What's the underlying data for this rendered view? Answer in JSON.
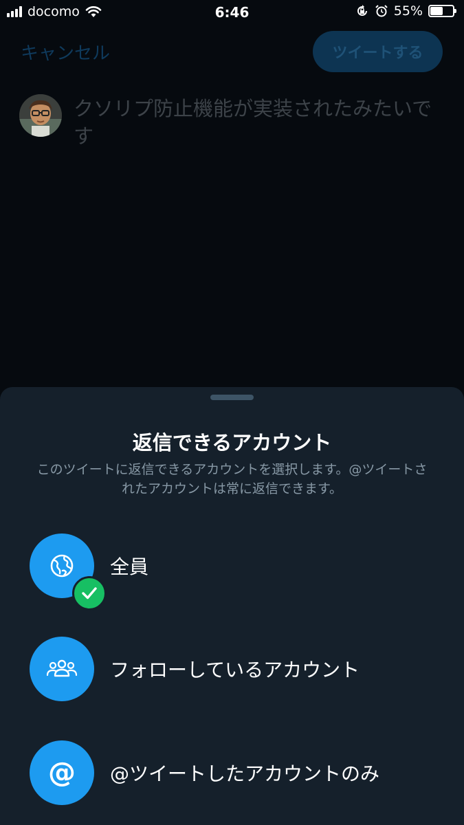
{
  "status_bar": {
    "carrier": "docomo",
    "time": "6:46",
    "battery_percent": "55%",
    "battery_level": 0.55,
    "icons": [
      "signal-icon",
      "wifi-icon",
      "orientation-lock-icon",
      "alarm-icon",
      "battery-icon"
    ]
  },
  "compose": {
    "cancel_label": "キャンセル",
    "tweet_button_label": "ツイートする",
    "draft_text": "クソリプ防止機能が実装されたみたいです"
  },
  "reply_sheet": {
    "title": "返信できるアカウント",
    "description": "このツイートに返信できるアカウントを選択します。@ツイートされたアカウントは常に返信できます。",
    "options": [
      {
        "label": "全員",
        "icon": "globe-icon",
        "selected": true
      },
      {
        "label": "フォローしているアカウント",
        "icon": "people-icon",
        "selected": false
      },
      {
        "label": "@ツイートしたアカウントのみ",
        "icon": "at-icon",
        "selected": false
      }
    ]
  },
  "colors": {
    "accent": "#1d9bf0",
    "check": "#17bf63",
    "sheet_background": "#15202b",
    "secondary_text": "#8899a6"
  }
}
